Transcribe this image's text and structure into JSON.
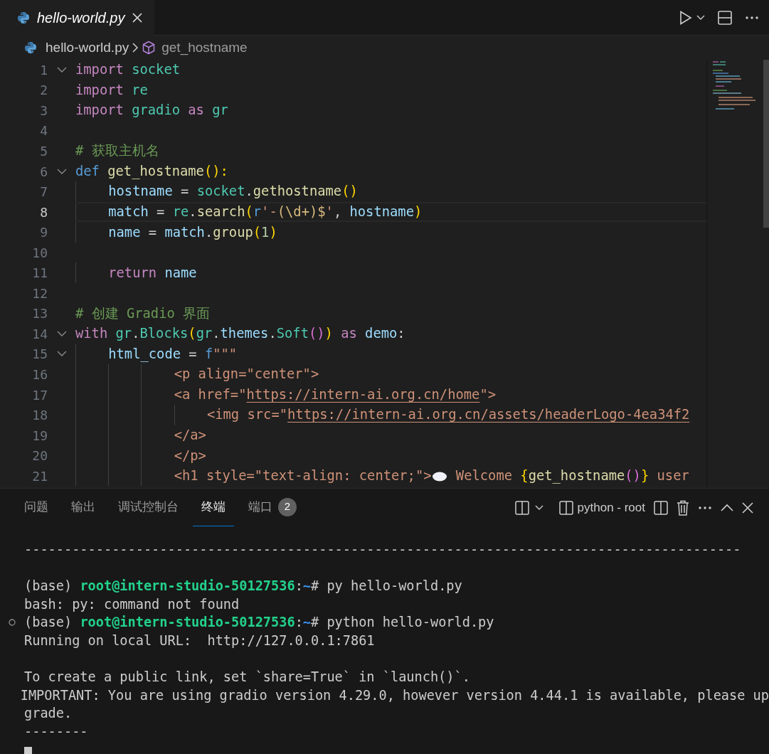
{
  "editor_tabs": [
    {
      "label": "hello-world.py",
      "selected": true,
      "preview": true
    }
  ],
  "breadcrumb": {
    "file": "hello-world.py",
    "symbol": "get_hostname"
  },
  "code_lines": [
    {
      "number": "1",
      "foldable": true,
      "current": false,
      "tokens": [
        {
          "kind": "keyword",
          "text": "import"
        },
        {
          "kind": "module",
          "text": " socket"
        }
      ]
    },
    {
      "number": "2",
      "foldable": false,
      "current": false,
      "tokens": [
        {
          "kind": "keyword",
          "text": "import"
        },
        {
          "kind": "module",
          "text": " re"
        }
      ]
    },
    {
      "number": "3",
      "foldable": false,
      "current": false,
      "tokens": [
        {
          "kind": "keyword",
          "text": "import"
        },
        {
          "kind": "module",
          "text": " gradio"
        },
        {
          "kind": "keyword",
          "text": " as"
        },
        {
          "kind": "module",
          "text": " gr"
        }
      ]
    },
    {
      "number": "4",
      "foldable": false,
      "current": false
    },
    {
      "number": "5",
      "foldable": false,
      "current": false,
      "tokens": [
        {
          "kind": "comment",
          "text": "# 获取主机名"
        }
      ]
    },
    {
      "number": "6",
      "foldable": true,
      "current": false,
      "tokens": [
        {
          "kind": "storage",
          "text": "def"
        },
        {
          "kind": "function",
          "text": " get_hostname"
        },
        {
          "kind": "bracket1",
          "text": "():"
        }
      ]
    },
    {
      "number": "7",
      "foldable": false,
      "current": false,
      "tokens": [
        {
          "kind": "variable",
          "text": "    hostname"
        },
        {
          "kind": "plain",
          "text": " = "
        },
        {
          "kind": "module",
          "text": "socket"
        },
        {
          "kind": "plain",
          "text": "."
        },
        {
          "kind": "function",
          "text": "gethostname"
        },
        {
          "kind": "bracket1",
          "text": "()"
        }
      ]
    },
    {
      "number": "8",
      "foldable": false,
      "current": true,
      "tokens": [
        {
          "kind": "variable",
          "text": "    match"
        },
        {
          "kind": "plain",
          "text": " = "
        },
        {
          "kind": "module",
          "text": "re"
        },
        {
          "kind": "plain",
          "text": "."
        },
        {
          "kind": "function",
          "text": "search"
        },
        {
          "kind": "bracket1",
          "text": "("
        },
        {
          "kind": "storage",
          "text": "r"
        },
        {
          "kind": "string",
          "text": "'-"
        },
        {
          "kind": "regex",
          "text": "(\\d+)$"
        },
        {
          "kind": "string",
          "text": "'"
        },
        {
          "kind": "plain",
          "text": ","
        },
        {
          "kind": "variable",
          "text": " hostname"
        },
        {
          "kind": "bracket1",
          "text": ")"
        }
      ]
    },
    {
      "number": "9",
      "foldable": false,
      "current": false,
      "tokens": [
        {
          "kind": "variable",
          "text": "    name"
        },
        {
          "kind": "plain",
          "text": " = "
        },
        {
          "kind": "variable",
          "text": "match"
        },
        {
          "kind": "plain",
          "text": "."
        },
        {
          "kind": "function",
          "text": "group"
        },
        {
          "kind": "bracket1",
          "text": "("
        },
        {
          "kind": "number",
          "text": "1"
        },
        {
          "kind": "bracket1",
          "text": ")"
        }
      ]
    },
    {
      "number": "10",
      "foldable": false,
      "current": false
    },
    {
      "number": "11",
      "foldable": false,
      "current": false,
      "tokens": [
        {
          "kind": "keyword",
          "text": "    return"
        },
        {
          "kind": "variable",
          "text": " name"
        }
      ]
    },
    {
      "number": "12",
      "foldable": false,
      "current": false
    },
    {
      "number": "13",
      "foldable": false,
      "current": false,
      "tokens": [
        {
          "kind": "comment",
          "text": "# 创建 Gradio 界面"
        }
      ]
    },
    {
      "number": "14",
      "foldable": true,
      "current": false,
      "tokens": [
        {
          "kind": "keyword",
          "text": "with"
        },
        {
          "kind": "module",
          "text": " gr"
        },
        {
          "kind": "plain",
          "text": "."
        },
        {
          "kind": "module",
          "text": "Blocks"
        },
        {
          "kind": "bracket1",
          "text": "("
        },
        {
          "kind": "module",
          "text": "gr"
        },
        {
          "kind": "plain",
          "text": "."
        },
        {
          "kind": "variable",
          "text": "themes"
        },
        {
          "kind": "plain",
          "text": "."
        },
        {
          "kind": "module",
          "text": "Soft"
        },
        {
          "kind": "bracket2",
          "text": "()"
        },
        {
          "kind": "bracket1",
          "text": ")"
        },
        {
          "kind": "keyword",
          "text": " as"
        },
        {
          "kind": "variable",
          "text": " demo"
        },
        {
          "kind": "plain",
          "text": ":"
        }
      ]
    },
    {
      "number": "15",
      "foldable": true,
      "current": false,
      "tokens": [
        {
          "kind": "variable",
          "text": "    html_code"
        },
        {
          "kind": "plain",
          "text": " = "
        },
        {
          "kind": "storage",
          "text": "f"
        },
        {
          "kind": "string",
          "text": "\"\"\""
        }
      ]
    },
    {
      "number": "16",
      "foldable": false,
      "current": false,
      "tokens": [
        {
          "kind": "string",
          "text": "            <p align=\"center\">"
        }
      ]
    },
    {
      "number": "17",
      "foldable": false,
      "current": false,
      "tokens": [
        {
          "kind": "string",
          "text": "            <a href=\""
        },
        {
          "kind": "link",
          "text": "https://intern-ai.org.cn/home"
        },
        {
          "kind": "string",
          "text": "\">"
        }
      ]
    },
    {
      "number": "18",
      "foldable": false,
      "current": false,
      "tokens": [
        {
          "kind": "string",
          "text": "                <img src=\""
        },
        {
          "kind": "link",
          "text": "https://intern-ai.org.cn/assets/headerLogo-4ea34f2"
        }
      ]
    },
    {
      "number": "19",
      "foldable": false,
      "current": false,
      "tokens": [
        {
          "kind": "string",
          "text": "            </a>"
        }
      ]
    },
    {
      "number": "20",
      "foldable": false,
      "current": false,
      "tokens": [
        {
          "kind": "string",
          "text": "            </p>"
        }
      ]
    },
    {
      "number": "21",
      "foldable": false,
      "current": false,
      "tokens": [
        {
          "kind": "string",
          "text": "            <h1 style=\"text-align: center;\">"
        },
        {
          "kind": "emoji"
        },
        {
          "kind": "string",
          "text": " Welcome "
        },
        {
          "kind": "bracket1",
          "text": "{"
        },
        {
          "kind": "function",
          "text": "get_hostname"
        },
        {
          "kind": "bracket2",
          "text": "()"
        },
        {
          "kind": "bracket1",
          "text": "}"
        },
        {
          "kind": "string",
          "text": " user"
        }
      ]
    }
  ],
  "panel_tabs": [
    {
      "label": "问题",
      "selected": false
    },
    {
      "label": "输出",
      "selected": false
    },
    {
      "label": "调试控制台",
      "selected": false
    },
    {
      "label": "终端",
      "selected": true
    },
    {
      "label": "端口",
      "selected": false,
      "badge": "2"
    }
  ],
  "terminal_name": "python - root",
  "terminal_lines": [
    {
      "decorated": false,
      "segments": [
        {
          "kind": "plain",
          "text": "------------------------------------------------------------------------------------------"
        }
      ]
    },
    {
      "decorated": false
    },
    {
      "decorated": false,
      "segments": [
        {
          "kind": "plain",
          "text": "(base) "
        },
        {
          "kind": "user",
          "text": "root@intern-studio-50127536"
        },
        {
          "kind": "plain",
          "text": ":"
        },
        {
          "kind": "path",
          "text": "~"
        },
        {
          "kind": "plain",
          "text": "# py hello-world.py"
        }
      ]
    },
    {
      "decorated": false,
      "segments": [
        {
          "kind": "plain",
          "text": "bash: py: command not found"
        }
      ]
    },
    {
      "decorated": true,
      "segments": [
        {
          "kind": "plain",
          "text": "(base) "
        },
        {
          "kind": "user",
          "text": "root@intern-studio-50127536"
        },
        {
          "kind": "plain",
          "text": ":"
        },
        {
          "kind": "path",
          "text": "~"
        },
        {
          "kind": "plain",
          "text": "# python hello-world.py"
        }
      ]
    },
    {
      "decorated": false,
      "segments": [
        {
          "kind": "plain",
          "text": "Running on local URL:  http://127.0.0.1:7861"
        }
      ]
    },
    {
      "decorated": false
    },
    {
      "decorated": false,
      "segments": [
        {
          "kind": "plain",
          "text": "To create a public link, set `share=True` in `launch()`."
        }
      ]
    },
    {
      "decorated": false,
      "segments": [
        {
          "kind": "plain",
          "text": "IMPORTANT: You are using gradio version 4.29.0, however version 4.44.1 is available, please up"
        }
      ]
    },
    {
      "decorated": false,
      "segments": [
        {
          "kind": "plain",
          "text": "grade."
        }
      ]
    },
    {
      "decorated": false,
      "segments": [
        {
          "kind": "plain",
          "text": "--------"
        }
      ]
    }
  ],
  "terminal_cursor": true
}
